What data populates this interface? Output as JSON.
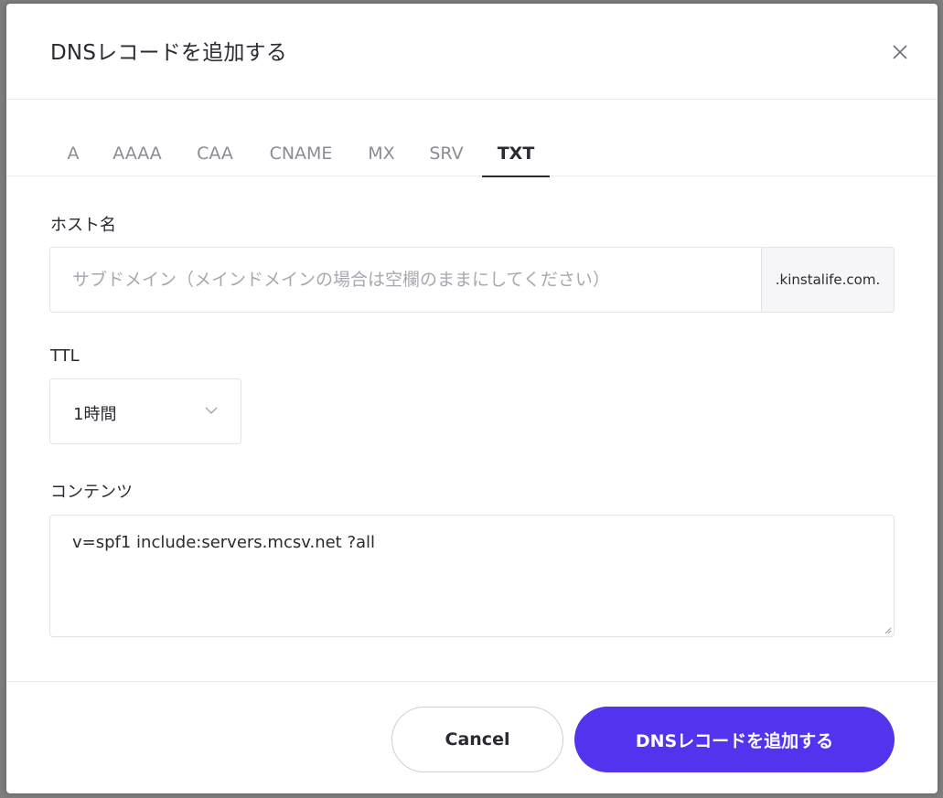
{
  "modal": {
    "title": "DNSレコードを追加する"
  },
  "tabs": [
    {
      "label": "A"
    },
    {
      "label": "AAAA"
    },
    {
      "label": "CAA"
    },
    {
      "label": "CNAME"
    },
    {
      "label": "MX"
    },
    {
      "label": "SRV"
    },
    {
      "label": "TXT",
      "active": true
    }
  ],
  "host": {
    "label": "ホスト名",
    "placeholder": "サブドメイン（メインドメインの場合は空欄のままにしてください）",
    "value": "",
    "suffix": ".kinstalife.com."
  },
  "ttl": {
    "label": "TTL",
    "selected": "1時間"
  },
  "content": {
    "label": "コンテンツ",
    "value": "v=spf1 include:servers.mcsv.net ?all"
  },
  "footer": {
    "cancel_label": "Cancel",
    "submit_label": "DNSレコードを追加する"
  },
  "colors": {
    "accent": "#5333ed",
    "text": "#2a2a33",
    "muted": "#8b8b96"
  },
  "icons": {
    "close": "close-icon",
    "chevron": "chevron-down-icon",
    "resize": "resize-handle-icon"
  }
}
